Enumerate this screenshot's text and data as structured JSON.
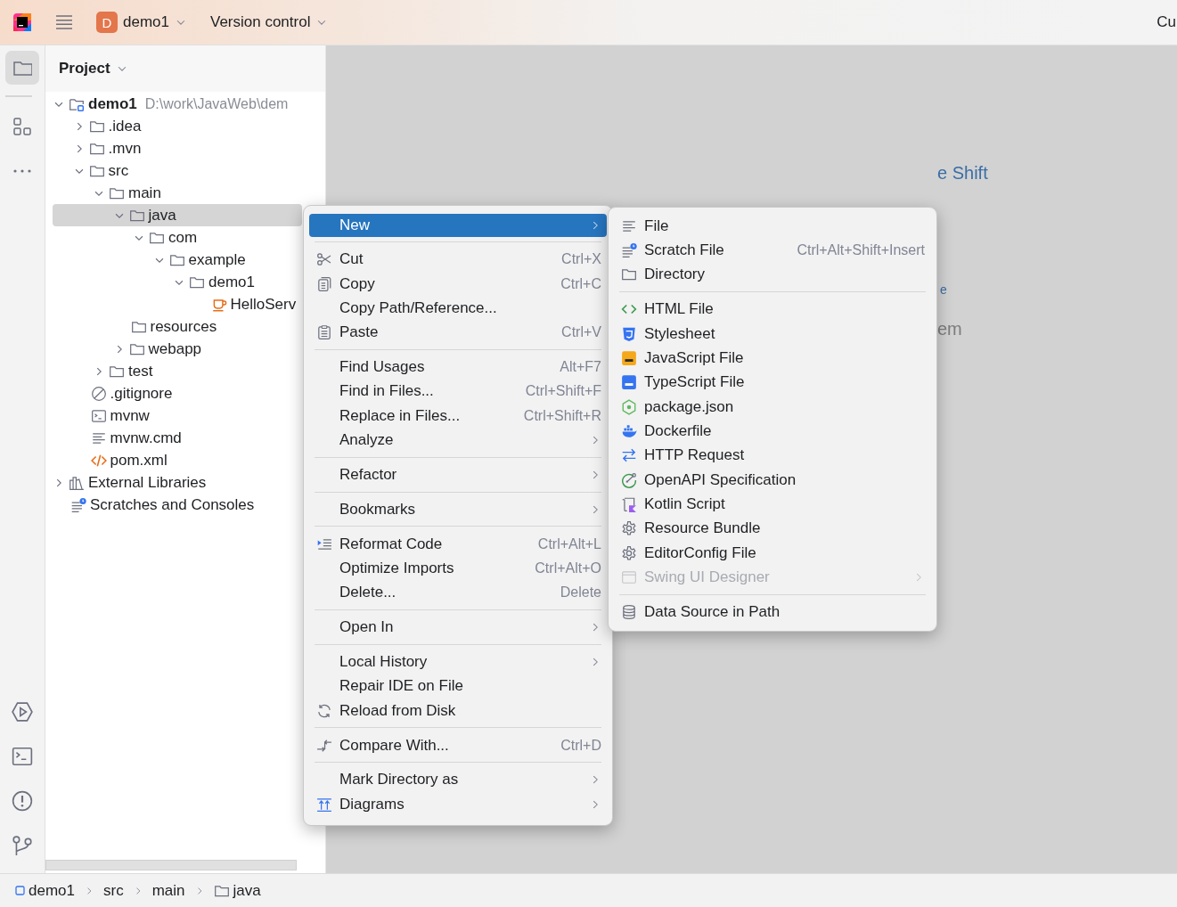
{
  "topbar": {
    "project_badge": "D",
    "project": "demo1",
    "vcs": "Version control",
    "cut_text": "Cu"
  },
  "tool_strip": {
    "top": [
      {
        "selected": true
      },
      {
        "selected": false
      }
    ],
    "bottom": [
      {
        "selected": false
      },
      {
        "selected": false
      },
      {
        "selected": false
      },
      {
        "selected": false
      }
    ]
  },
  "project_panel": {
    "title": "Project",
    "tree": [
      {
        "name": "demo1",
        "path": "D:\\work\\JavaWeb\\dem",
        "kind": "module",
        "expanded": true,
        "selected": false,
        "children": [
          {
            "name": ".idea",
            "kind": "folder",
            "expanded": false,
            "selected": false
          },
          {
            "name": ".mvn",
            "kind": "folder",
            "expanded": false,
            "selected": false
          },
          {
            "name": "src",
            "kind": "folder",
            "expanded": true,
            "selected": false,
            "children": [
              {
                "name": "main",
                "kind": "folder",
                "expanded": true,
                "selected": false,
                "children": [
                  {
                    "name": "java",
                    "kind": "folder",
                    "expanded": true,
                    "selected": true,
                    "children": [
                      {
                        "name": "com",
                        "kind": "folder",
                        "expanded": true,
                        "selected": false,
                        "children": [
                          {
                            "name": "example",
                            "kind": "folder",
                            "expanded": true,
                            "selected": false,
                            "children": [
                              {
                                "name": "demo1",
                                "kind": "folder",
                                "expanded": true,
                                "selected": false,
                                "children": [
                                  {
                                    "name": "HelloServ",
                                    "kind": "java-class",
                                    "selected": false
                                  }
                                ]
                              }
                            ]
                          }
                        ]
                      }
                    ]
                  },
                  {
                    "name": "resources",
                    "kind": "folder",
                    "selected": false
                  },
                  {
                    "name": "webapp",
                    "kind": "folder",
                    "expanded": false,
                    "selected": false
                  }
                ]
              },
              {
                "name": "test",
                "kind": "folder",
                "expanded": false,
                "selected": false
              }
            ]
          },
          {
            "name": ".gitignore",
            "kind": "ignore-file",
            "selected": false
          },
          {
            "name": "mvnw",
            "kind": "shell-script",
            "selected": false
          },
          {
            "name": "mvnw.cmd",
            "kind": "text-file",
            "selected": false
          },
          {
            "name": "pom.xml",
            "kind": "xml-file",
            "selected": false
          }
        ]
      },
      {
        "name": "External Libraries",
        "kind": "libraries",
        "expanded": false,
        "selected": false
      },
      {
        "name": "Scratches and Consoles",
        "kind": "scratches",
        "selected": false
      }
    ]
  },
  "context_menu": {
    "groups": [
      [
        {
          "label": "New",
          "submenu": true,
          "selected": true
        }
      ],
      [
        {
          "label": "Cut",
          "shortcut": "Ctrl+X",
          "submenu": false,
          "selected": false
        },
        {
          "label": "Copy",
          "shortcut": "Ctrl+C",
          "submenu": false,
          "selected": false
        },
        {
          "label": "Copy Path/Reference...",
          "submenu": false,
          "selected": false
        },
        {
          "label": "Paste",
          "shortcut": "Ctrl+V",
          "submenu": false,
          "selected": false
        }
      ],
      [
        {
          "label": "Find Usages",
          "shortcut": "Alt+F7",
          "submenu": false,
          "selected": false
        },
        {
          "label": "Find in Files...",
          "shortcut": "Ctrl+Shift+F",
          "submenu": false,
          "selected": false
        },
        {
          "label": "Replace in Files...",
          "shortcut": "Ctrl+Shift+R",
          "submenu": false,
          "selected": false
        },
        {
          "label": "Analyze",
          "submenu": true,
          "selected": false
        }
      ],
      [
        {
          "label": "Refactor",
          "submenu": true,
          "selected": false
        }
      ],
      [
        {
          "label": "Bookmarks",
          "submenu": true,
          "selected": false
        }
      ],
      [
        {
          "label": "Reformat Code",
          "shortcut": "Ctrl+Alt+L",
          "submenu": false,
          "selected": false
        },
        {
          "label": "Optimize Imports",
          "shortcut": "Ctrl+Alt+O",
          "submenu": false,
          "selected": false
        },
        {
          "label": "Delete...",
          "shortcut": "Delete",
          "submenu": false,
          "selected": false
        }
      ],
      [
        {
          "label": "Open In",
          "submenu": true,
          "selected": false
        }
      ],
      [
        {
          "label": "Local History",
          "submenu": true,
          "selected": false
        },
        {
          "label": "Repair IDE on File",
          "submenu": false,
          "selected": false
        },
        {
          "label": "Reload from Disk",
          "submenu": false,
          "selected": false
        }
      ],
      [
        {
          "label": "Compare With...",
          "shortcut": "Ctrl+D",
          "submenu": false,
          "selected": false
        }
      ],
      [
        {
          "label": "Mark Directory as",
          "submenu": true,
          "selected": false
        },
        {
          "label": "Diagrams",
          "submenu": true,
          "selected": false
        }
      ]
    ]
  },
  "new_submenu": {
    "groups": [
      [
        {
          "label": "File",
          "submenu": false,
          "disabled": false
        },
        {
          "label": "Scratch File",
          "shortcut": "Ctrl+Alt+Shift+Insert",
          "submenu": false,
          "disabled": false
        },
        {
          "label": "Directory",
          "submenu": false,
          "disabled": false
        }
      ],
      [
        {
          "label": "HTML File",
          "submenu": false,
          "disabled": false
        },
        {
          "label": "Stylesheet",
          "submenu": false,
          "disabled": false
        },
        {
          "label": "JavaScript File",
          "submenu": false,
          "disabled": false
        },
        {
          "label": "TypeScript File",
          "submenu": false,
          "disabled": false
        },
        {
          "label": "package.json",
          "submenu": false,
          "disabled": false
        },
        {
          "label": "Dockerfile",
          "submenu": false,
          "disabled": false
        },
        {
          "label": "HTTP Request",
          "submenu": false,
          "disabled": false
        },
        {
          "label": "OpenAPI Specification",
          "submenu": false,
          "disabled": false
        },
        {
          "label": "Kotlin Script",
          "submenu": false,
          "disabled": false
        },
        {
          "label": "Resource Bundle",
          "submenu": false,
          "disabled": false
        },
        {
          "label": "EditorConfig File",
          "submenu": false,
          "disabled": false
        },
        {
          "label": "Swing UI Designer",
          "submenu": true,
          "disabled": true
        }
      ],
      [
        {
          "label": "Data Source in Path",
          "submenu": false,
          "disabled": false
        }
      ]
    ]
  },
  "editor": {
    "hints": [
      {
        "text": "e Shift",
        "kind": "link"
      },
      {
        "text": "e",
        "kind": "link"
      },
      {
        "text": "em",
        "kind": "plain"
      }
    ]
  },
  "status_bar": {
    "breadcrumbs": [
      {
        "label": "demo1",
        "kind": "module"
      },
      {
        "label": "src",
        "kind": "plain"
      },
      {
        "label": "main",
        "kind": "plain"
      },
      {
        "label": "java",
        "kind": "folder"
      }
    ]
  }
}
